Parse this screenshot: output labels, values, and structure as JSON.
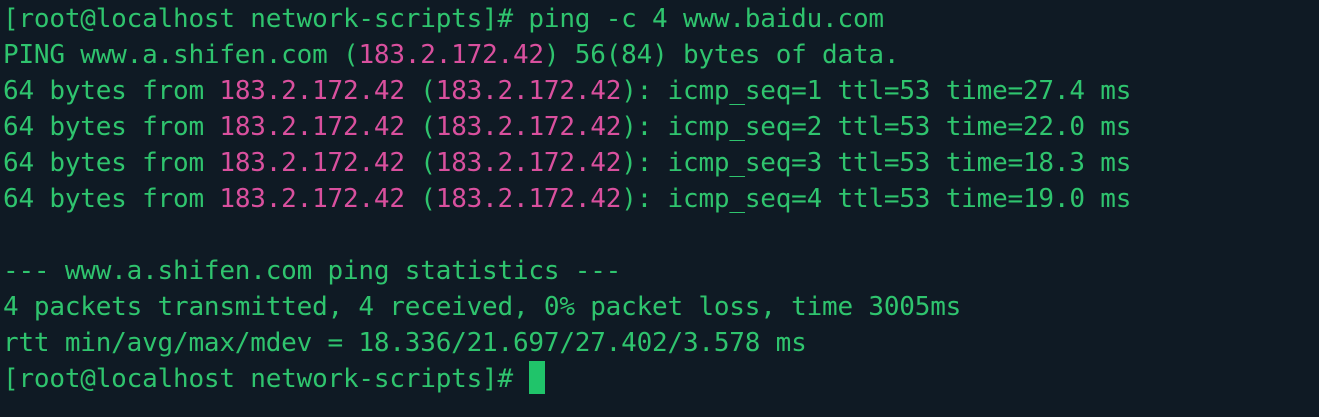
{
  "terminal": {
    "prompt": "[root@localhost network-scripts]#",
    "command": " ping -c 4 www.baidu.com",
    "ping_header": {
      "prefix": "PING www.a.shifen.com (",
      "ip": "183.2.172.42",
      "suffix": ") 56(84) bytes of data."
    },
    "replies": [
      {
        "from": "64 bytes from ",
        "ip1": "183.2.172.42",
        "mid": " (",
        "ip2": "183.2.172.42",
        "rest": "): icmp_seq=1 ttl=53 time=27.4 ms"
      },
      {
        "from": "64 bytes from ",
        "ip1": "183.2.172.42",
        "mid": " (",
        "ip2": "183.2.172.42",
        "rest": "): icmp_seq=2 ttl=53 time=22.0 ms"
      },
      {
        "from": "64 bytes from ",
        "ip1": "183.2.172.42",
        "mid": " (",
        "ip2": "183.2.172.42",
        "rest": "): icmp_seq=3 ttl=53 time=18.3 ms"
      },
      {
        "from": "64 bytes from ",
        "ip1": "183.2.172.42",
        "mid": " (",
        "ip2": "183.2.172.42",
        "rest": "): icmp_seq=4 ttl=53 time=19.0 ms"
      }
    ],
    "stats_header": "--- www.a.shifen.com ping statistics ---",
    "stats_packets": "4 packets transmitted, 4 received, 0% packet loss, time 3005ms",
    "stats_rtt": "rtt min/avg/max/mdev = 18.336/21.697/27.402/3.578 ms",
    "final_prompt": "[root@localhost network-scripts]#"
  },
  "colors": {
    "background": "#0f1a24",
    "text": "#2fc46e",
    "ip_highlight": "#d9509e",
    "cursor": "#20c46a"
  }
}
